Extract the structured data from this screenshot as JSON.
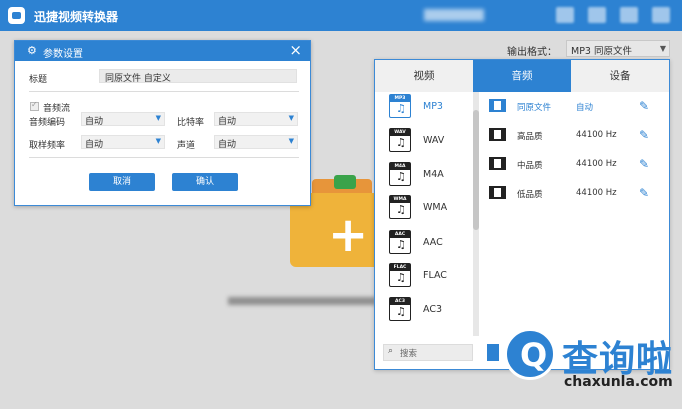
{
  "app": {
    "title": "迅捷视频转换器"
  },
  "output": {
    "label": "输出格式：",
    "value": "MP3  同原文件"
  },
  "dialog": {
    "title": "参数设置",
    "title_label": "标题",
    "title_value": "同原文件 自定义",
    "audio_stream_label": "音频流",
    "audio_codec_label": "音频编码",
    "audio_codec_value": "自动",
    "bitrate_label": "比特率",
    "bitrate_value": "自动",
    "samplerate_label": "取样频率",
    "samplerate_value": "自动",
    "channel_label": "声道",
    "channel_value": "自动",
    "cancel": "取消",
    "confirm": "确认"
  },
  "panel": {
    "tabs": [
      "视频",
      "音频",
      "设备"
    ],
    "active_tab": 1,
    "formats": [
      "MP3",
      "WAV",
      "M4A",
      "WMA",
      "AAC",
      "FLAC",
      "AC3"
    ],
    "qualities": [
      {
        "name": "同原文件",
        "value": "自动"
      },
      {
        "name": "高品质",
        "value": "44100 Hz"
      },
      {
        "name": "中品质",
        "value": "44100 Hz"
      },
      {
        "name": "低品质",
        "value": "44100 Hz"
      }
    ],
    "search_placeholder": "搜索"
  },
  "watermark": {
    "cn": "查询啦",
    "en": "chaxunla.com"
  },
  "colors": {
    "accent": "#2d82d2"
  }
}
